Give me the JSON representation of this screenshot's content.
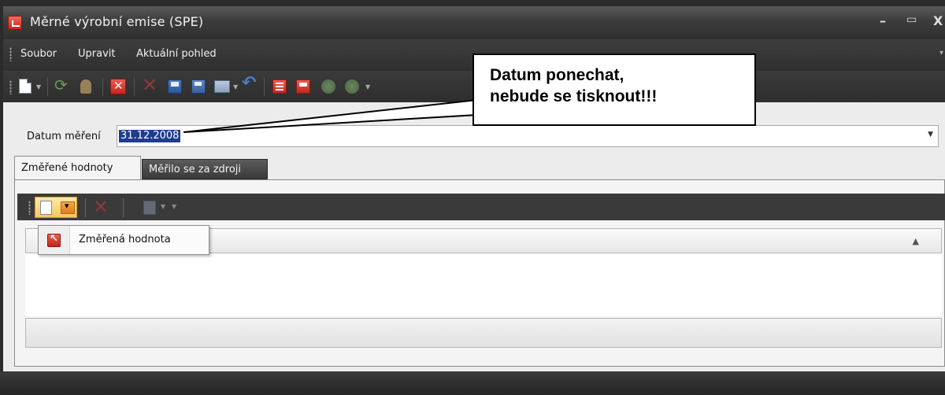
{
  "window": {
    "title": "Měrné výrobní emise (SPE)",
    "minimize_glyph": "–",
    "maximize_glyph": "▭",
    "close_glyph": "X"
  },
  "menu": [
    "Soubor",
    "Upravit",
    "Aktuální pohled"
  ],
  "callout": {
    "line1": "Datum ponechat,",
    "line2": "nebude se tisknout!!!"
  },
  "date": {
    "label": "Datum měření",
    "value": "31.12.2008"
  },
  "tabs": [
    "Změřené hodnoty",
    "Měřilo se za zdroji"
  ],
  "dropdown": {
    "item_label": "Změřená hodnota"
  },
  "icons": {
    "toolbar": [
      "new-document-icon",
      "refresh-icon",
      "hand-icon",
      "delete-icon",
      "cross-icon",
      "save-icon",
      "save-all-icon",
      "export-icon",
      "undo-icon",
      "report-icon",
      "report2-icon",
      "move-up-icon",
      "move-down-icon"
    ],
    "subtoolbar": [
      "new-document-icon",
      "delete-icon",
      "copy-icon"
    ]
  },
  "colors": {
    "titlebar": "#3c3c3c",
    "selection": "#1f3d8f",
    "accent_red": "#c5281c",
    "dropdown_highlight": "#f6c85c"
  }
}
